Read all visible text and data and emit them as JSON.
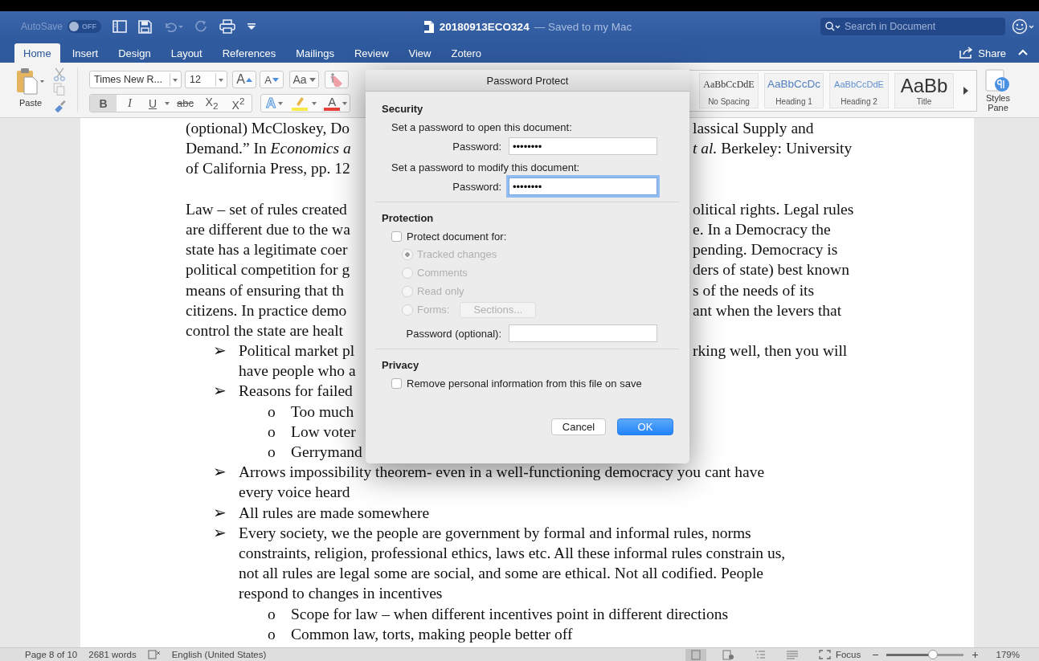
{
  "title_bar": {
    "autosave_label": "AutoSave",
    "autosave": {
      "label": "OFF",
      "on": false
    },
    "doc_name": "20180913ECO324",
    "doc_status": "— Saved to my Mac",
    "search": {
      "placeholder": "Search in Document"
    }
  },
  "tabs": [
    {
      "label": "Home",
      "selected": true
    },
    {
      "label": "Insert",
      "selected": false
    },
    {
      "label": "Design",
      "selected": false
    },
    {
      "label": "Layout",
      "selected": false
    },
    {
      "label": "References",
      "selected": false
    },
    {
      "label": "Mailings",
      "selected": false
    },
    {
      "label": "Review",
      "selected": false
    },
    {
      "label": "View",
      "selected": false
    },
    {
      "label": "Zotero",
      "selected": false
    }
  ],
  "share": {
    "label": "Share"
  },
  "ribbon": {
    "paste": "Paste",
    "font_name": "Times New R...",
    "font_size": "12",
    "font_buttons": [
      {
        "kind": "grow",
        "label": "A"
      },
      {
        "kind": "shrink",
        "label": "A"
      },
      {
        "kind": "case",
        "label": "Aa"
      },
      {
        "kind": "clear"
      }
    ],
    "format_buttons": [
      {
        "kind": "bold",
        "label": "B",
        "selected": true
      },
      {
        "kind": "italic",
        "label": "I",
        "selected": false
      },
      {
        "kind": "underline",
        "label": "U",
        "selected": false
      },
      {
        "kind": "strike",
        "label": "abc",
        "selected": false
      },
      {
        "kind": "subscript",
        "label": "X$_{2}$",
        "selected": false
      },
      {
        "kind": "superscript",
        "label": "X$^{2}$",
        "selected": false
      }
    ],
    "color_buttons": [
      {
        "kind": "effects",
        "label": "A"
      },
      {
        "kind": "highlight",
        "color": "#f7ea4a"
      },
      {
        "kind": "font-color",
        "label": "A",
        "color": "#e8413c"
      }
    ],
    "styles": [
      {
        "kind": "plain",
        "preview": "AaBbCcDdE",
        "label": "No Spacing"
      },
      {
        "kind": "heading1",
        "preview": "AaBbCcDc",
        "label": "Heading 1"
      },
      {
        "kind": "heading2",
        "preview": "AaBbCcDdE",
        "label": "Heading 2"
      },
      {
        "kind": "title",
        "preview": "AaBb",
        "label": "Title"
      }
    ],
    "styles_pane": "Styles Pane"
  },
  "document": {
    "blocks": [
      {
        "kind": "para",
        "lines": [
          {
            "left": "(optional) McCloskey, Do",
            "right": "lassical Supply and"
          },
          {
            "left": "Demand.” In *Economics a*",
            "right": "*t al.* Berkeley: University"
          },
          {
            "left": "of California Press, pp. 12"
          }
        ]
      },
      {
        "kind": "para",
        "lines": [
          {
            "left": "Law – set of rules created",
            "right": "olitical rights. Legal rules"
          },
          {
            "left": "are different due to the wa",
            "right": "e. In a Democracy the"
          },
          {
            "left": "state has a legitimate coer",
            "right": "pending. Democracy is"
          },
          {
            "left": "political competition for g",
            "right": "ders of state) best known"
          },
          {
            "left": "means of ensuring that th",
            "right": "s of the needs of its"
          },
          {
            "left": "citizens. In practice demo",
            "right": "ant when the levers that"
          },
          {
            "left": "control the state are healt"
          }
        ]
      },
      {
        "kind": "bullet",
        "bullet": "➢",
        "lines": [
          {
            "left": "Political market pl",
            "right": "rking well, then you will"
          },
          {
            "left": "have people who a"
          }
        ]
      },
      {
        "kind": "bullet",
        "bullet": "➢",
        "lines": [
          {
            "left": "Reasons for failed"
          }
        ],
        "children": [
          {
            "kind": "bullet",
            "bullet": "o",
            "lines": [
              {
                "left": "Too much"
              }
            ]
          },
          {
            "kind": "bullet",
            "bullet": "o",
            "lines": [
              {
                "left": "Low voter"
              }
            ]
          },
          {
            "kind": "bullet",
            "bullet": "o",
            "lines": [
              {
                "left": "Gerrymand"
              }
            ]
          }
        ]
      },
      {
        "kind": "bullet",
        "bullet": "➢",
        "lines": [
          {
            "left": "Arrows impossibility theorem- even in a well-functioning democracy you cant have"
          },
          {
            "left": "every voice heard"
          }
        ]
      },
      {
        "kind": "bullet",
        "bullet": "➢",
        "lines": [
          {
            "left": "All rules are made somewhere"
          }
        ]
      },
      {
        "kind": "bullet",
        "bullet": "➢",
        "lines": [
          {
            "left": "Every society, we the people are government by formal and informal rules, norms"
          },
          {
            "left": "constraints, religion, professional ethics, laws etc. All these informal rules constrain us,"
          },
          {
            "left": "not all rules are legal some are social, and some are ethical. Not all codified. People"
          },
          {
            "left": "respond to changes in incentives"
          }
        ],
        "children": [
          {
            "kind": "bullet",
            "bullet": "o",
            "lines": [
              {
                "left": "Scope for law – when different incentives point in different directions"
              }
            ]
          },
          {
            "kind": "bullet",
            "bullet": "o",
            "lines": [
              {
                "left": "Common law, torts, making people better off"
              }
            ]
          }
        ]
      }
    ]
  },
  "dialog": {
    "title": "Password Protect",
    "security": {
      "heading": "Security",
      "fields": [
        {
          "prompt": "Set a password to open this document:",
          "label": "Password:",
          "value": "••••••••",
          "focused": false
        },
        {
          "prompt": "Set a password to modify this document:",
          "label": "Password:",
          "value": "••••••••",
          "focused": true
        }
      ]
    },
    "protection": {
      "heading": "Protection",
      "checkbox": {
        "label": "Protect document for:",
        "checked": false
      },
      "options": [
        {
          "label": "Tracked changes",
          "selected": true,
          "disabled": true
        },
        {
          "label": "Comments",
          "selected": false,
          "disabled": true
        },
        {
          "label": "Read only",
          "selected": false,
          "disabled": true
        },
        {
          "label": "Forms:",
          "selected": false,
          "disabled": true,
          "button": {
            "label": "Sections...",
            "disabled": true
          }
        }
      ],
      "password": {
        "label": "Password (optional):"
      }
    },
    "privacy": {
      "heading": "Privacy",
      "checkbox": {
        "label": "Remove personal information from this file on save",
        "checked": false
      }
    },
    "buttons": [
      {
        "label": "Cancel",
        "kind": "cancel"
      },
      {
        "label": "OK",
        "kind": "default"
      }
    ]
  },
  "status_bar": {
    "page": "Page 8 of 10",
    "words": "2681 words",
    "language": "English (United States)",
    "views": [
      {
        "kind": "print",
        "selected": true
      },
      {
        "kind": "web",
        "selected": false
      },
      {
        "kind": "outline",
        "selected": false
      },
      {
        "kind": "draft",
        "selected": false
      }
    ],
    "focus": "Focus",
    "zoom": {
      "minus": "−",
      "plus": "+",
      "level": 0.6,
      "reading": "179%"
    }
  }
}
